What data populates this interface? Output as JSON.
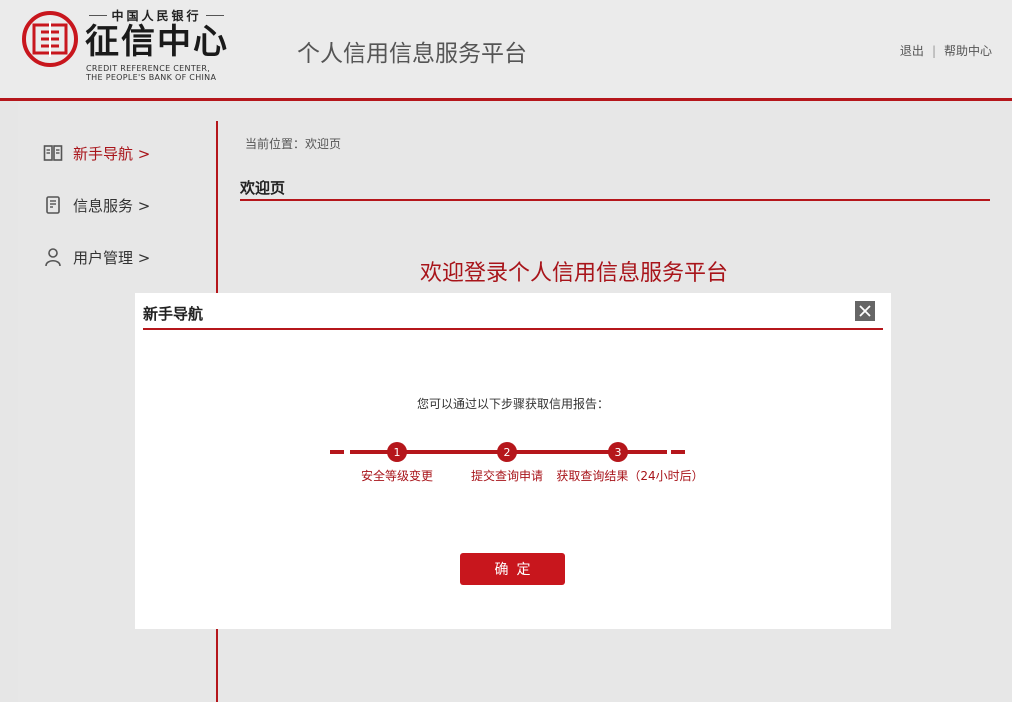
{
  "header": {
    "logo_top": "中国人民银行",
    "logo_main": "征信中心",
    "logo_en_line1": "CREDIT REFERENCE CENTER,",
    "logo_en_line2": "THE PEOPLE'S BANK OF CHINA",
    "site_title": "个人信用信息服务平台",
    "logout_label": "退出",
    "separator": "|",
    "help_label": "帮助中心"
  },
  "sidebar": {
    "items": [
      {
        "label": "新手导航 >",
        "icon": "book-icon",
        "active": true
      },
      {
        "label": "信息服务 >",
        "icon": "document-icon",
        "active": false
      },
      {
        "label": "用户管理 >",
        "icon": "user-icon",
        "active": false
      }
    ]
  },
  "main": {
    "breadcrumb": "当前位置：欢迎页",
    "page_title": "欢迎页",
    "welcome_text": "欢迎登录个人信用信息服务平台"
  },
  "modal": {
    "title": "新手导航",
    "close_icon": "close-icon",
    "description": "您可以通过以下步骤获取信用报告：",
    "steps": [
      {
        "number": "1",
        "label": "安全等级变更"
      },
      {
        "number": "2",
        "label": "提交查询申请"
      },
      {
        "number": "3",
        "label": "获取查询结果（24小时后）"
      }
    ],
    "confirm_label": "确定"
  },
  "colors": {
    "accent": "#b5161b",
    "button": "#c8161d",
    "background": "#e6e6e6"
  }
}
